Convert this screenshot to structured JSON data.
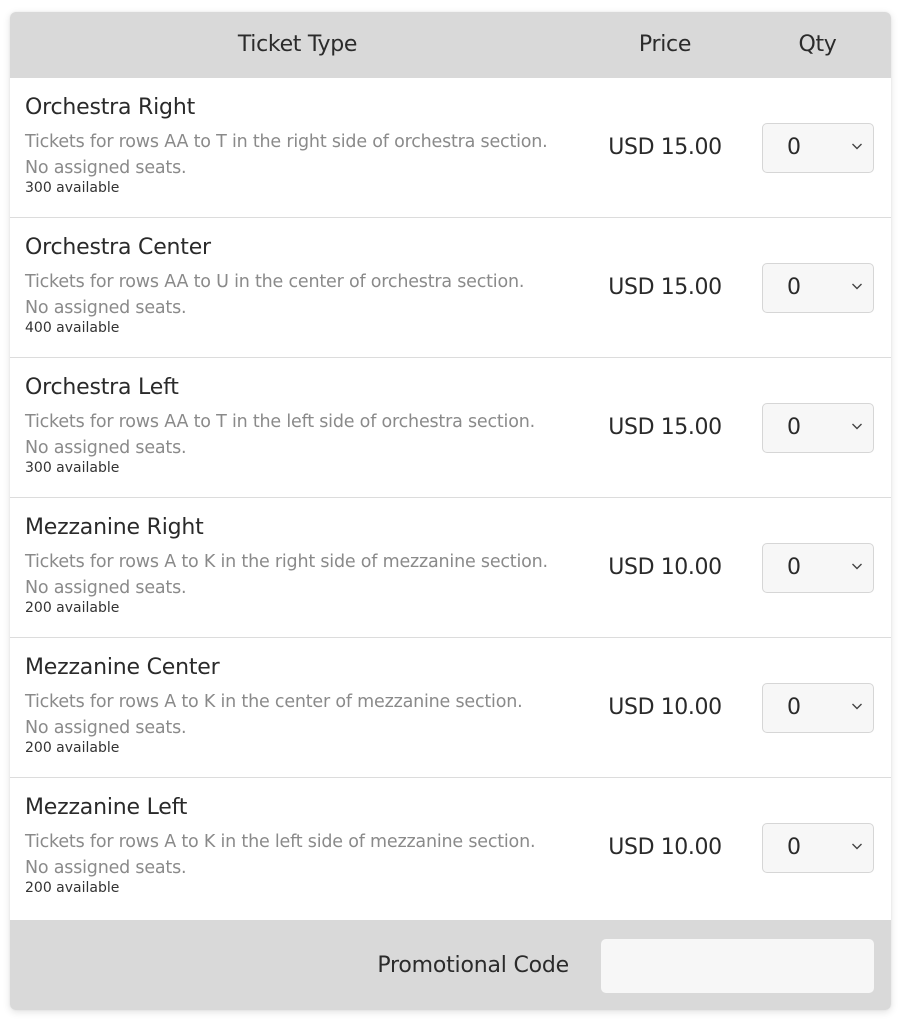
{
  "table": {
    "headers": {
      "ticket_type": "Ticket Type",
      "price": "Price",
      "qty": "Qty"
    },
    "rows": [
      {
        "name": "Orchestra Right",
        "description_line1": "Tickets for rows AA to T in the right side of orchestra section.",
        "description_line2": "No assigned seats.",
        "availability": "300 available",
        "price": "USD 15.00",
        "qty": "0"
      },
      {
        "name": "Orchestra Center",
        "description_line1": "Tickets for rows AA to U in the center of orchestra section.",
        "description_line2": "No assigned seats.",
        "availability": "400 available",
        "price": "USD 15.00",
        "qty": "0"
      },
      {
        "name": "Orchestra Left",
        "description_line1": "Tickets for rows AA to T in the left side of orchestra section.",
        "description_line2": "No assigned seats.",
        "availability": "300 available",
        "price": "USD 15.00",
        "qty": "0"
      },
      {
        "name": "Mezzanine Right",
        "description_line1": "Tickets for rows A to K in the right side of mezzanine section.",
        "description_line2": "No assigned seats.",
        "availability": "200 available",
        "price": "USD 10.00",
        "qty": "0"
      },
      {
        "name": "Mezzanine Center",
        "description_line1": "Tickets for rows A to K in the center of mezzanine section.",
        "description_line2": "No assigned seats.",
        "availability": "200 available",
        "price": "USD 10.00",
        "qty": "0"
      },
      {
        "name": "Mezzanine Left",
        "description_line1": "Tickets for rows A to K in the left side of mezzanine section.",
        "description_line2": "No assigned seats.",
        "availability": "200 available",
        "price": "USD 10.00",
        "qty": "0"
      }
    ]
  },
  "footer": {
    "promo_label": "Promotional Code",
    "promo_value": "",
    "promo_placeholder": ""
  },
  "icons": {
    "qty_dropdown": "chevron-down-icon"
  },
  "colors": {
    "header_bg": "#d9d9d9",
    "row_bg": "#ffffff",
    "text_primary": "#2a2a2a",
    "text_secondary": "#8a8a8a",
    "select_bg": "#f7f7f7",
    "divider": "#dcdcdc"
  }
}
